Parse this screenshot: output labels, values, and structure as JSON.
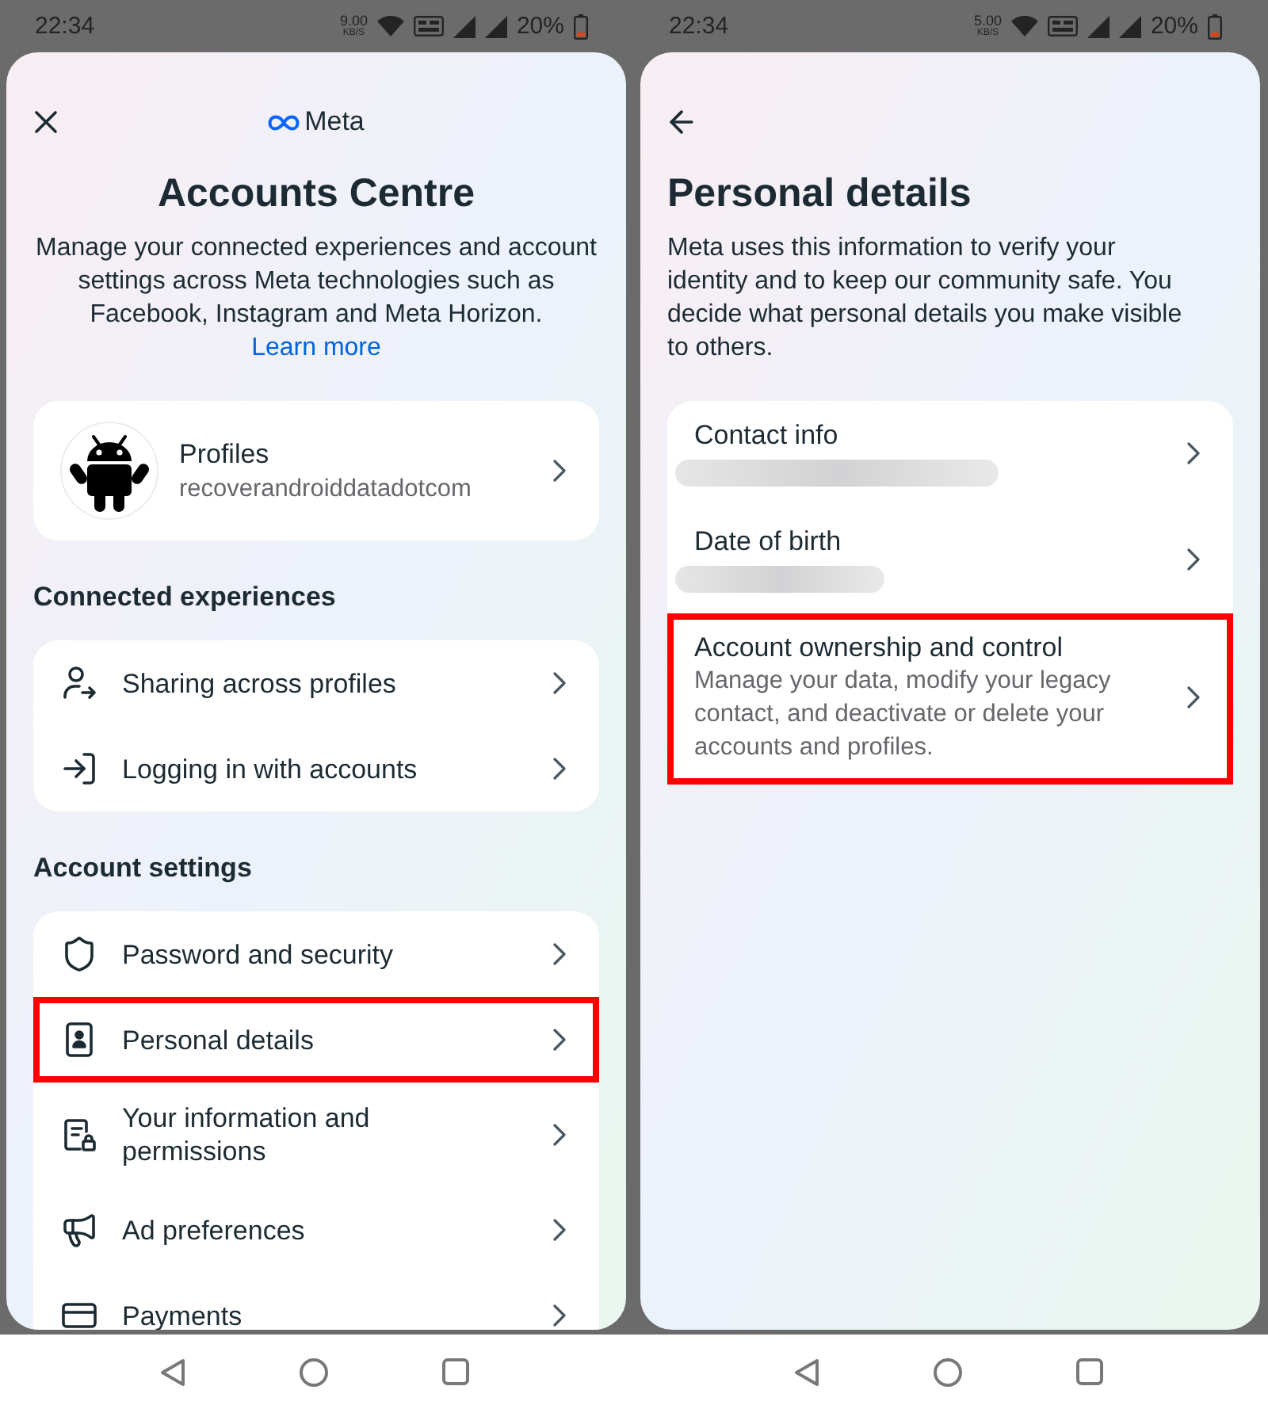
{
  "screens": [
    {
      "kind": "overview",
      "status_bar": {
        "time": "22:34",
        "speed": "9.00",
        "speed_unit": "KB/S",
        "battery": "20%"
      },
      "header": {
        "kind": "close",
        "logo": "Meta"
      },
      "title": "Accounts Centre",
      "description": "Manage your connected experiences and account settings across Meta technologies such as Facebook, Instagram and Meta Horizon.",
      "link": "Learn more",
      "sections": [
        {
          "items": [
            {
              "kind": "profile",
              "label": "Profiles",
              "subtitle": "recoverandroiddatadotcom",
              "highlighted": false
            }
          ]
        },
        {
          "heading": "Connected experiences",
          "items": [
            {
              "kind": "sharing",
              "label": "Sharing across profiles",
              "highlighted": false
            },
            {
              "kind": "login",
              "label": "Logging in with accounts",
              "highlighted": false
            }
          ]
        },
        {
          "heading": "Account settings",
          "items": [
            {
              "kind": "security",
              "label": "Password and security",
              "highlighted": false
            },
            {
              "kind": "personal",
              "label": "Personal details",
              "highlighted": true
            },
            {
              "kind": "permissions",
              "label": "Your information and permissions",
              "highlighted": false
            },
            {
              "kind": "ads",
              "label": "Ad preferences",
              "highlighted": false
            },
            {
              "kind": "payments",
              "label": "Payments",
              "highlighted": false
            }
          ]
        }
      ]
    },
    {
      "kind": "detail",
      "status_bar": {
        "time": "22:34",
        "speed": "5.00",
        "speed_unit": "KB/S",
        "battery": "20%"
      },
      "header": {
        "kind": "back"
      },
      "title": "Personal details",
      "description": "Meta uses this information to verify your identity and to keep our community safe. You decide what personal details you make visible to others.",
      "sections": [
        {
          "items": [
            {
              "kind": "detail",
              "label": "Contact info",
              "redacted": true,
              "highlighted": false
            },
            {
              "kind": "detail",
              "label": "Date of birth",
              "redacted": true,
              "highlighted": false
            },
            {
              "kind": "detail",
              "label": "Account ownership and control",
              "subtitle": "Manage your data, modify your legacy contact, and deactivate or delete your accounts and profiles.",
              "highlighted": true
            }
          ]
        }
      ]
    }
  ]
}
